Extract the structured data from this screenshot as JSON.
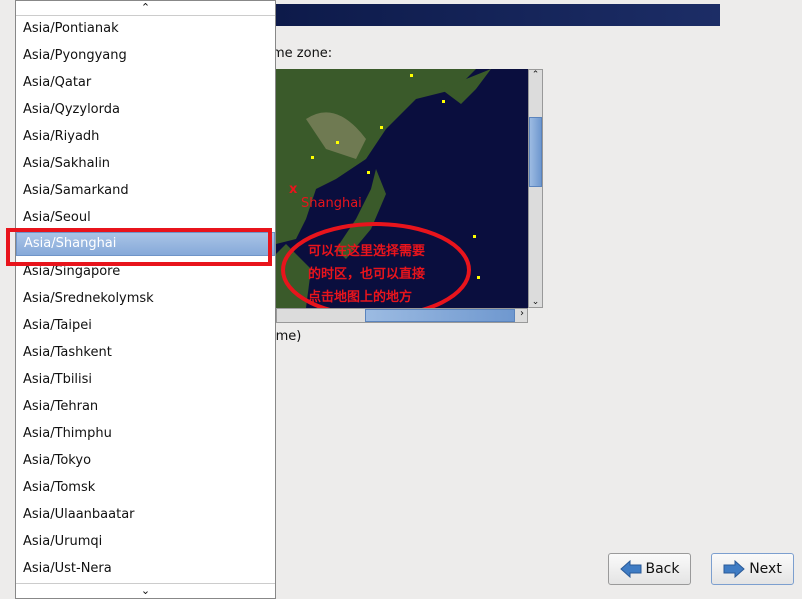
{
  "header": {
    "partial_label": "me zone:",
    "partial_utc_label": "ime)"
  },
  "map": {
    "selected_city": "Shanghai",
    "marker": "x",
    "annotation_lines": [
      "可以在这里选择需要",
      "的时区，也可以直接",
      "点击地图上的地方"
    ],
    "annotation_color": "#e8141c"
  },
  "timezone_list": {
    "items": [
      "Asia/Pontianak",
      "Asia/Pyongyang",
      "Asia/Qatar",
      "Asia/Qyzylorda",
      "Asia/Riyadh",
      "Asia/Sakhalin",
      "Asia/Samarkand",
      "Asia/Seoul",
      "Asia/Shanghai",
      "Asia/Singapore",
      "Asia/Srednekolymsk",
      "Asia/Taipei",
      "Asia/Tashkent",
      "Asia/Tbilisi",
      "Asia/Tehran",
      "Asia/Thimphu",
      "Asia/Tokyo",
      "Asia/Tomsk",
      "Asia/Ulaanbaatar",
      "Asia/Urumqi",
      "Asia/Ust-Nera"
    ],
    "selected": "Asia/Shanghai"
  },
  "buttons": {
    "back": "Back",
    "next": "Next"
  }
}
